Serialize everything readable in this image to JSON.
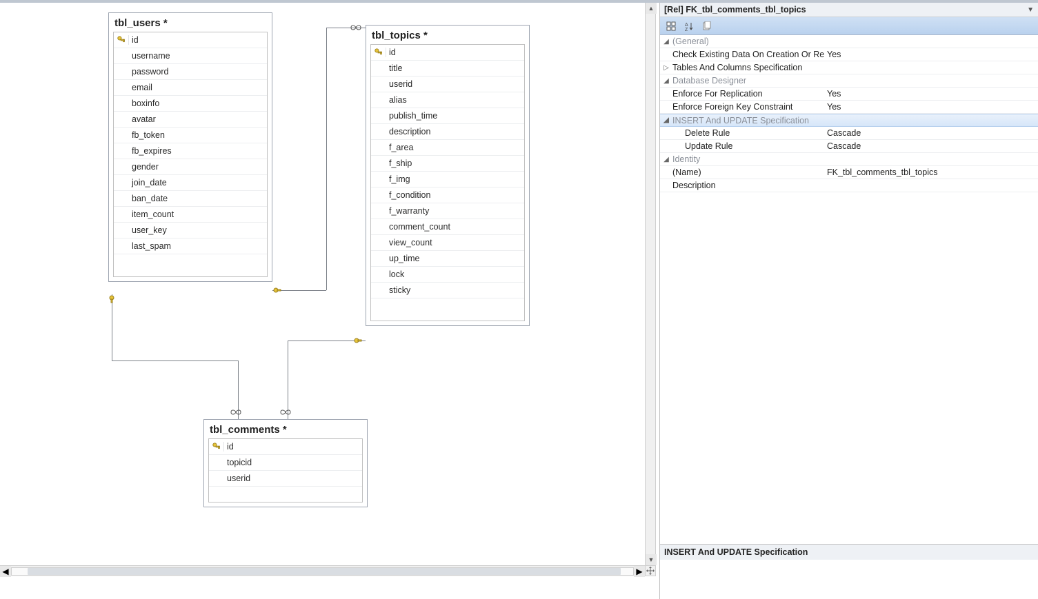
{
  "diagram": {
    "tables": {
      "users": {
        "title": "tbl_users *",
        "columns": [
          "id",
          "username",
          "password",
          "email",
          "boxinfo",
          "avatar",
          "fb_token",
          "fb_expires",
          "gender",
          "join_date",
          "ban_date",
          "item_count",
          "user_key",
          "last_spam"
        ],
        "pk_index": 0
      },
      "topics": {
        "title": "tbl_topics *",
        "columns": [
          "id",
          "title",
          "userid",
          "alias",
          "publish_time",
          "description",
          "f_area",
          "f_ship",
          "f_img",
          "f_condition",
          "f_warranty",
          "comment_count",
          "view_count",
          "up_time",
          "lock",
          "sticky"
        ],
        "pk_index": 0
      },
      "comments": {
        "title": "tbl_comments *",
        "columns": [
          "id",
          "topicid",
          "userid"
        ],
        "pk_index": 0
      }
    }
  },
  "props": {
    "title": "[Rel] FK_tbl_comments_tbl_topics",
    "categories": {
      "general": {
        "label": "(General)",
        "items": [
          {
            "label": "Check Existing Data On Creation Or Re-En",
            "value": "Yes"
          },
          {
            "label": "Tables And Columns Specification",
            "value": "",
            "expand": true
          }
        ]
      },
      "designer": {
        "label": "Database Designer",
        "items": [
          {
            "label": "Enforce For Replication",
            "value": "Yes"
          },
          {
            "label": "Enforce Foreign Key Constraint",
            "value": "Yes"
          }
        ]
      },
      "insupd": {
        "label": "INSERT And UPDATE Specification",
        "selected": true,
        "items": [
          {
            "label": "Delete Rule",
            "value": "Cascade",
            "indent": true
          },
          {
            "label": "Update Rule",
            "value": "Cascade",
            "indent": true
          }
        ]
      },
      "identity": {
        "label": "Identity",
        "items": [
          {
            "label": "(Name)",
            "value": "FK_tbl_comments_tbl_topics"
          },
          {
            "label": "Description",
            "value": ""
          }
        ]
      }
    },
    "footer_title": "INSERT And UPDATE Specification"
  }
}
